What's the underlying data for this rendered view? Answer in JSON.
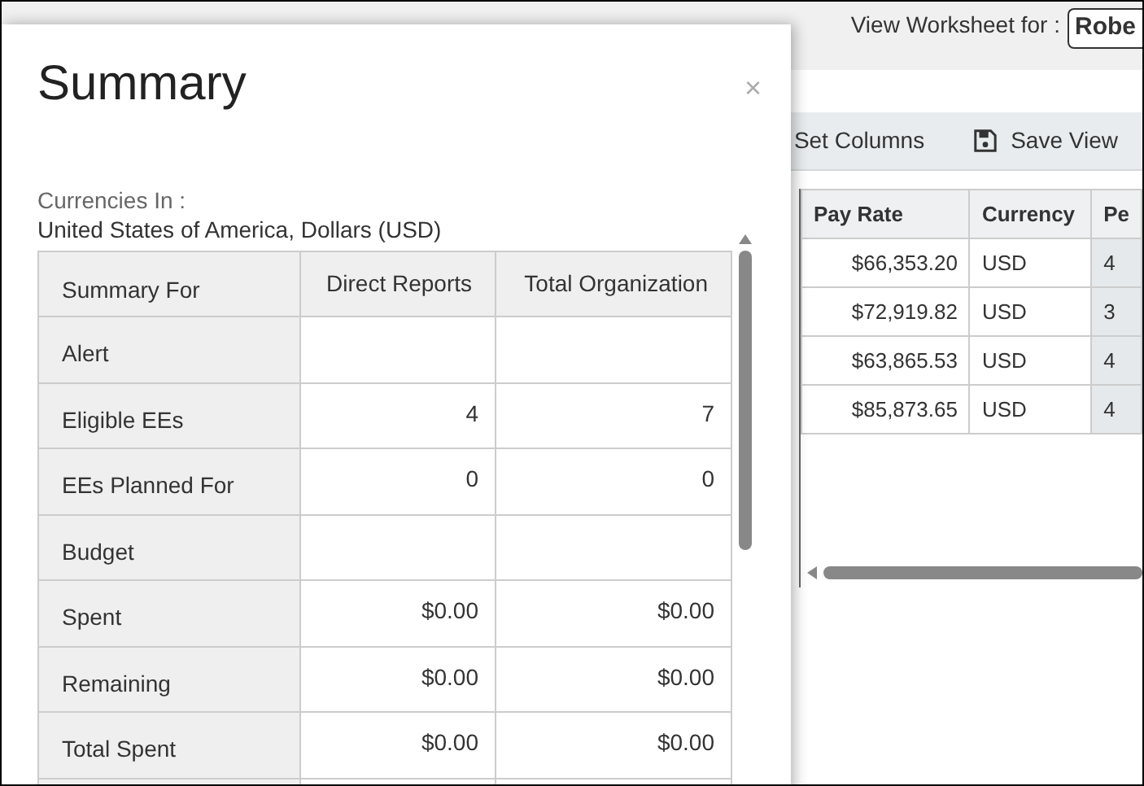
{
  "header": {
    "worksheet_for_label": "View Worksheet for :",
    "worksheet_for": "Robe"
  },
  "toolbar": {
    "buttons": [
      "Set Columns",
      "Save View"
    ]
  },
  "grid": {
    "columns": [
      "Pay Rate",
      "Currency",
      "Pe"
    ],
    "rows": [
      [
        "$66,353.20",
        "USD",
        "4"
      ],
      [
        "$72,919.82",
        "USD",
        "3"
      ],
      [
        "$63,865.53",
        "USD",
        "4"
      ],
      [
        "$85,873.65",
        "USD",
        "4"
      ]
    ]
  },
  "dialog": {
    "title": "Summary",
    "close": "×",
    "currencies_label": "Currencies In :",
    "currencies": "United States of America, Dollars (USD)",
    "columns": [
      "Summary For",
      "Direct Reports",
      "Total Organization"
    ],
    "rows": [
      [
        "Alert",
        "",
        ""
      ],
      [
        "Eligible EEs",
        "4",
        "7"
      ],
      [
        "EEs Planned For",
        "0",
        "0"
      ],
      [
        "Budget",
        "",
        ""
      ],
      [
        "Spent",
        "$0.00",
        "$0.00"
      ],
      [
        "Remaining",
        "$0.00",
        "$0.00"
      ],
      [
        "Total Spent",
        "$0.00",
        "$0.00"
      ]
    ]
  }
}
